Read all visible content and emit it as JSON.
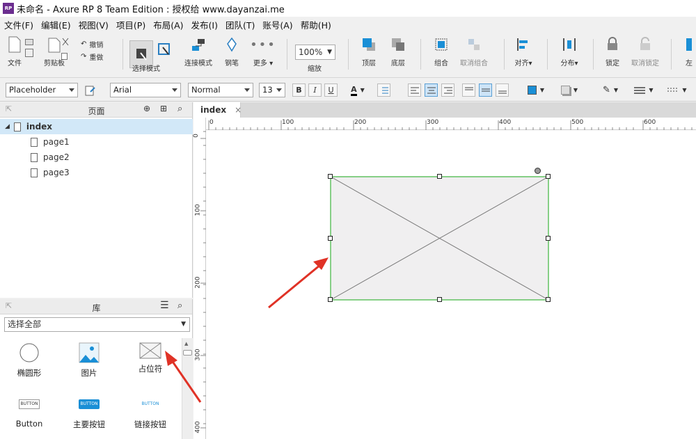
{
  "window": {
    "title": "未命名 - Axure RP 8 Team Edition : 授权给 www.dayanzai.me",
    "logo": "RP"
  },
  "menu": [
    "文件(F)",
    "编辑(E)",
    "视图(V)",
    "项目(P)",
    "布局(A)",
    "发布(I)",
    "团队(T)",
    "账号(A)",
    "帮助(H)"
  ],
  "toolbar": {
    "file": "文件",
    "clipboard": "剪贴板",
    "undo": "撤销",
    "redo": "重做",
    "select_mode": "选择模式",
    "connect_mode": "连接模式",
    "pen": "钢笔",
    "more": "更多",
    "zoom_value": "100%",
    "zoom": "缩放",
    "top_layer": "顶层",
    "bottom_layer": "底层",
    "group": "组合",
    "ungroup": "取消组合",
    "align": "对齐",
    "distribute": "分布",
    "lock": "锁定",
    "unlock": "取消锁定",
    "left": "左"
  },
  "formatbar": {
    "widget_type": "Placeholder",
    "font": "Arial",
    "style": "Normal",
    "size": "13",
    "bold": "B",
    "italic": "I",
    "underline": "U",
    "text_color": "A"
  },
  "pages_panel": {
    "title": "页面",
    "pages": [
      {
        "name": "index",
        "selected": true
      },
      {
        "name": "page1"
      },
      {
        "name": "page2"
      },
      {
        "name": "page3"
      }
    ]
  },
  "library_panel": {
    "title": "库",
    "filter": "选择全部",
    "items": [
      {
        "label": "椭圆形",
        "icon": "ellipse-icon"
      },
      {
        "label": "图片",
        "icon": "image-icon"
      },
      {
        "label": "占位符",
        "icon": "placeholder-icon"
      },
      {
        "label": "Button",
        "icon": "button-icon",
        "caption": "BUTTON"
      },
      {
        "label": "主要按钮",
        "icon": "primary-button-icon",
        "caption": "BUTTON"
      },
      {
        "label": "链接按钮",
        "icon": "link-button-icon",
        "caption": "BUTTON"
      }
    ]
  },
  "tab": {
    "label": "index",
    "close": "×"
  },
  "ruler": {
    "h": [
      "0",
      "100",
      "200",
      "300",
      "400",
      "500",
      "600"
    ],
    "v": [
      "0",
      "100",
      "200",
      "300",
      "400"
    ]
  },
  "colors": {
    "accent": "#1a8fd6",
    "selection": "#3bb33b",
    "arrow": "#e03226"
  }
}
